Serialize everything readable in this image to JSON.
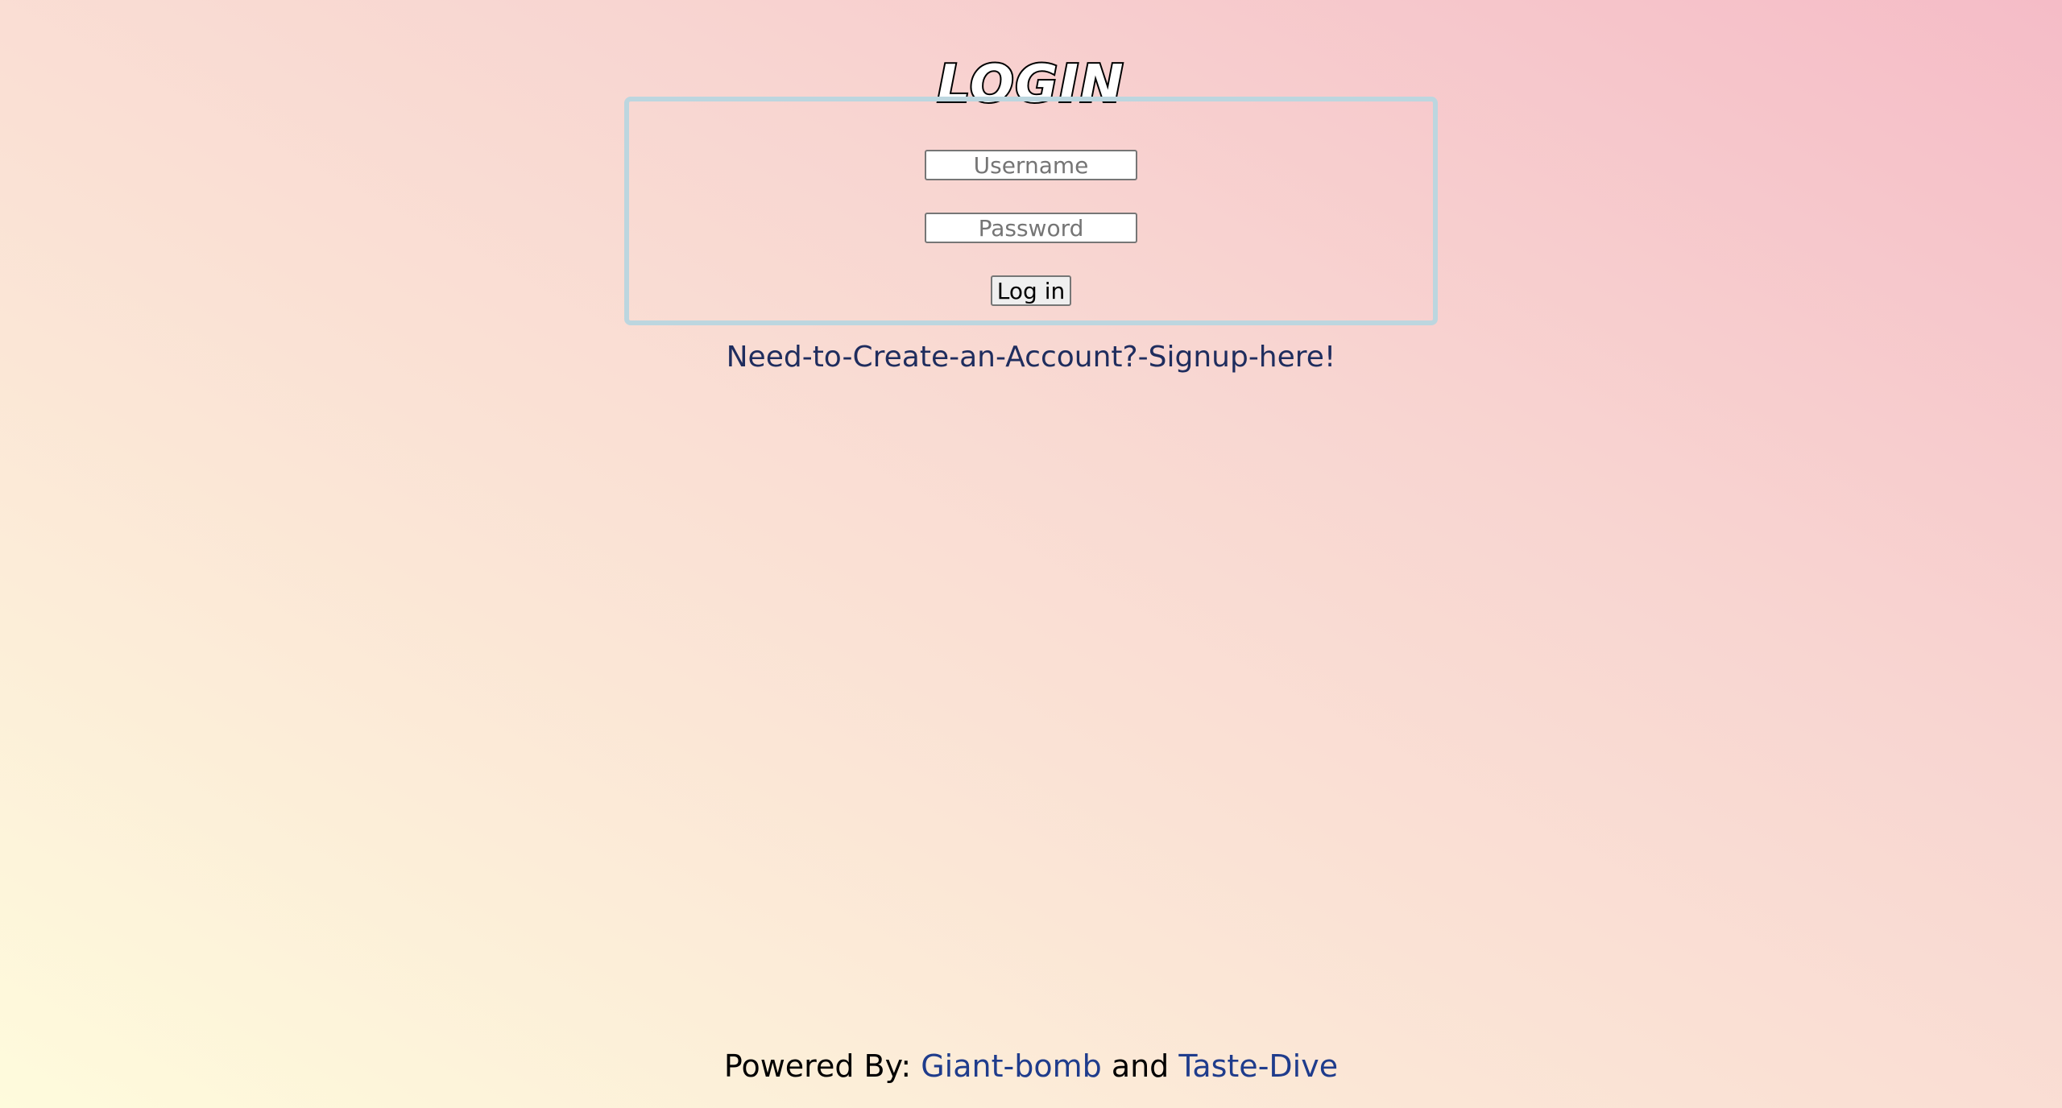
{
  "header": {
    "title": "LOGIN"
  },
  "form": {
    "username_placeholder": "Username",
    "username_value": "",
    "password_placeholder": "Password",
    "password_value": "",
    "login_label": "Log in"
  },
  "signup": {
    "link_text": "Need-to-Create-an-Account?-Signup-here!"
  },
  "footer": {
    "prefix": "Powered By:",
    "link1": "Giant-bomb",
    "conjunction": "and",
    "link2": "Taste-Dive"
  },
  "colors": {
    "link": "#1f2d5e",
    "box_border": "#bcd6df",
    "background_top_right": "#f5bcc7",
    "background_bottom_left": "#fefbdc"
  }
}
